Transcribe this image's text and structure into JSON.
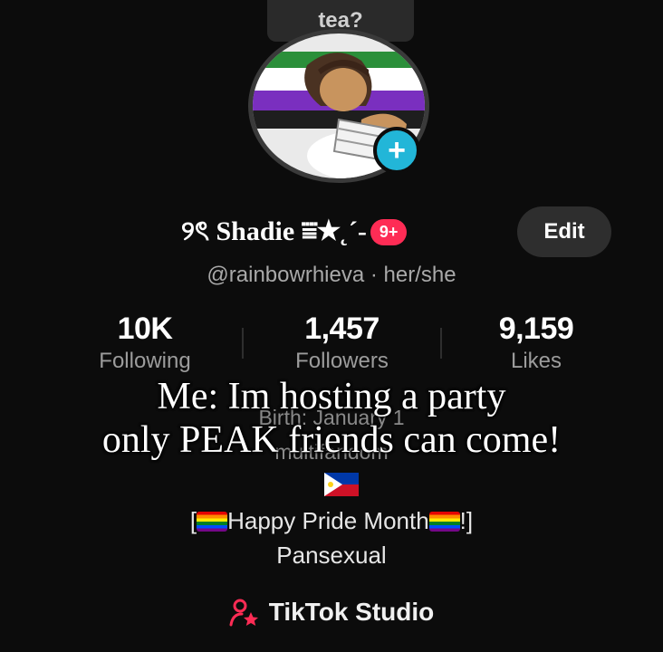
{
  "profile": {
    "avatar_tab_label": "tea?",
    "display_name": "୨ৎ Shadie ⩸★˛´-",
    "notification_badge": "9+",
    "edit_label": "Edit",
    "handle": "@rainbowrhieva · her/she"
  },
  "stats": [
    {
      "value": "10K",
      "label": "Following"
    },
    {
      "value": "1,457",
      "label": "Followers"
    },
    {
      "value": "9,159",
      "label": "Likes"
    }
  ],
  "bio": {
    "partial_line_1": "Birth: January 1",
    "partial_line_2": "multifandom",
    "pride_prefix": "[",
    "pride_text": "Happy Pride Month",
    "pride_suffix": "!]",
    "orientation": "Pansexual"
  },
  "caption": {
    "line1": "Me: Im hosting a party",
    "line2": "only PEAK friends can come!"
  },
  "studio": {
    "label": "TikTok Studio"
  },
  "colors": {
    "background": "#0c0c0c",
    "accent_pink": "#fe2c55",
    "plus_button": "#22b6d8",
    "edit_bg": "#2e2e2e"
  },
  "icons": {
    "add": "plus-icon",
    "studio": "person-star-icon",
    "flag": "philippines-flag-icon",
    "pride_flag": "rainbow-flag-icon"
  }
}
